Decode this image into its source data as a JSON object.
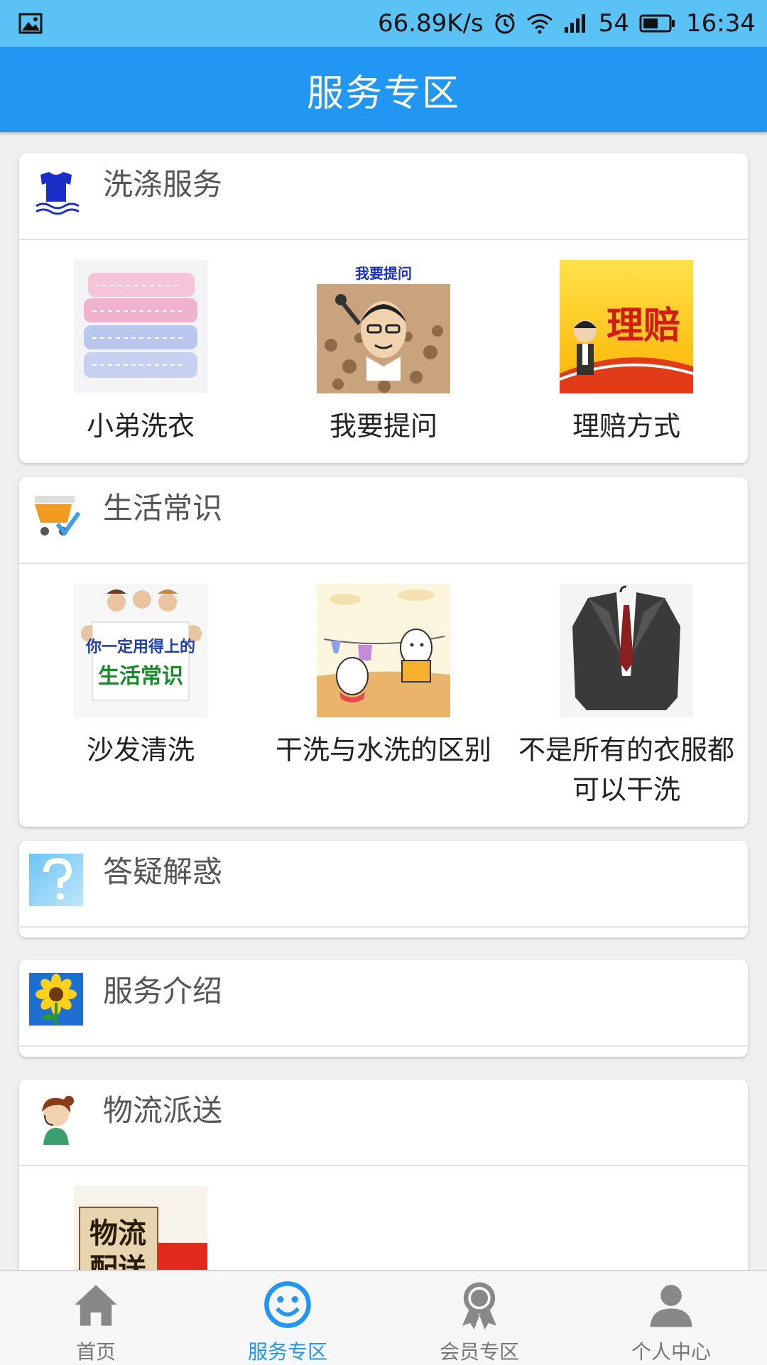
{
  "status_bar": {
    "network_speed": "66.89K/s",
    "battery": "54",
    "time": "16:34"
  },
  "app_bar": {
    "title": "服务专区"
  },
  "sections": [
    {
      "title": "洗涤服务",
      "icon": "laundry-shirt-icon",
      "items": [
        {
          "label": "小弟洗衣",
          "image": "folded-towels-image"
        },
        {
          "label": "我要提问",
          "image": "question-cartoon-image",
          "image_text": "我要提问"
        },
        {
          "label": "理赔方式",
          "image": "claims-banner-image",
          "image_text": "理赔"
        }
      ]
    },
    {
      "title": "生活常识",
      "icon": "shopping-cart-icon",
      "items": [
        {
          "label": "沙发清洗",
          "image": "people-sign-image",
          "image_text_line1": "你一定用得上的",
          "image_text_line2": "生活常识"
        },
        {
          "label": "干洗与水洗的区别",
          "image": "laundry-line-cartoon-image"
        },
        {
          "label": "不是所有的衣服都可以干洗",
          "image": "suit-jacket-image"
        }
      ]
    },
    {
      "title": "答疑解惑",
      "icon": "question-mark-icon",
      "items": []
    },
    {
      "title": "服务介绍",
      "icon": "sunflower-icon",
      "items": []
    },
    {
      "title": "物流派送",
      "icon": "headset-agent-icon",
      "items": [
        {
          "label": "",
          "image": "logistics-truck-image",
          "image_text_line1": "物流",
          "image_text_line2": "配送"
        }
      ]
    }
  ],
  "bottom_nav": [
    {
      "label": "首页",
      "icon": "home-icon",
      "active": false
    },
    {
      "label": "服务专区",
      "icon": "smiley-icon",
      "active": true
    },
    {
      "label": "会员专区",
      "icon": "medal-icon",
      "active": false
    },
    {
      "label": "个人中心",
      "icon": "person-icon",
      "active": false
    }
  ],
  "colors": {
    "primary": "#2196f3",
    "status_bar": "#5bc2f6",
    "background": "#efefef"
  }
}
